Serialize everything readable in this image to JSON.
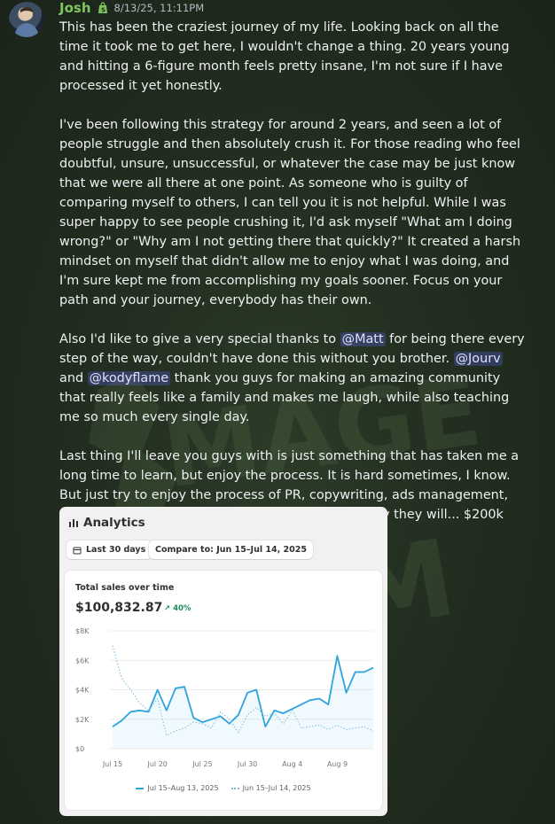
{
  "message": {
    "username": "Josh",
    "timestamp": "8/13/25, 11:11PM",
    "paragraph1": "This has been the craziest journey of my life. Looking back on all the time it took me to get here, I wouldn't change a thing. 20 years young and hitting a 6-figure month feels pretty insane, I'm not sure if I have processed it yet honestly.",
    "paragraph2": "I've been following this strategy for around 2 years, and seen a lot of people struggle and then absolutely crush it. For those reading who feel doubtful, unsure, unsuccessful, or whatever the case may be just know that we were all there at one point.  As someone who is guilty of comparing myself to others, I can tell you it is not helpful. While I was super happy to see people crushing it, I'd ask myself \"What am I doing wrong?\" or \"Why am I not getting there that quickly?\" It created a harsh mindset on myself that didn't allow me to enjoy what I was doing, and I'm sure kept me from accomplishing my goals sooner. Focus on your path and your journey, everybody has their own.",
    "p3_part1": "Also I'd like to give a very special thanks to ",
    "mention_matt": "@Matt",
    "p3_part2": " for being there every step of the way, couldn't have done this without you brother. ",
    "mention_jourv": "@Jourv",
    "p3_part3": "  and ",
    "mention_kodyflame": "@kodyflame",
    "p3_part4": " thank you guys for making an amazing community that really feels like a family and makes me laugh, while also teaching me so much every single day.",
    "paragraph4": "Last thing I'll leave you guys with is just something that has taken me a long time to learn, but enjoy the process. It is hard sometimes, I know. But just try to enjoy the process of PR, copywriting, ads management, even when things aren't going your way. Eventually they will... $200k month next ",
    "emoji": "saluting-face-emoji"
  },
  "analytics": {
    "title": "Analytics",
    "range_label": "Last 30 days",
    "compare_label": "Compare to: Jun 15–Jul 14, 2025",
    "sales_label": "Total sales over time",
    "sales_value": "$100,832.87",
    "sales_change": "40%",
    "legend_current": "Jul 15–Aug 13, 2025",
    "legend_previous": "Jun 15–Jul 14, 2025"
  },
  "chart_data": {
    "type": "line",
    "title": "Total sales over time",
    "y_ticks": [
      "$8K",
      "$6K",
      "$4K",
      "$2K",
      "$0"
    ],
    "x_ticks": [
      "Jul 15",
      "Jul 20",
      "Jul 25",
      "Jul 30",
      "Aug 4",
      "Aug 9"
    ],
    "ylim": [
      0,
      8000
    ],
    "x": [
      "Jul 15",
      "Jul 16",
      "Jul 17",
      "Jul 18",
      "Jul 19",
      "Jul 20",
      "Jul 21",
      "Jul 22",
      "Jul 23",
      "Jul 24",
      "Jul 25",
      "Jul 26",
      "Jul 27",
      "Jul 28",
      "Jul 29",
      "Jul 30",
      "Jul 31",
      "Aug 1",
      "Aug 2",
      "Aug 3",
      "Aug 4",
      "Aug 5",
      "Aug 6",
      "Aug 7",
      "Aug 8",
      "Aug 9",
      "Aug 10",
      "Aug 11",
      "Aug 12",
      "Aug 13"
    ],
    "series": [
      {
        "name": "Jul 15–Aug 13, 2025",
        "style": "solid",
        "color": "#2ea3dc",
        "values": [
          1500,
          1900,
          2500,
          2600,
          2500,
          4000,
          2600,
          4100,
          4200,
          2100,
          1800,
          2000,
          2200,
          1700,
          2300,
          3800,
          4000,
          1500,
          2600,
          2400,
          2700,
          3000,
          3300,
          3400,
          3000,
          6300,
          3800,
          5200,
          5200,
          5500
        ]
      },
      {
        "name": "Jun 15–Jul 14, 2025",
        "style": "dotted",
        "color": "#8cc3e3",
        "values": [
          7000,
          4800,
          4000,
          3100,
          2600,
          3400,
          900,
          1200,
          1400,
          1800,
          1700,
          1400,
          2500,
          2000,
          1100,
          2300,
          2800,
          2200,
          2400,
          1700,
          2600,
          1400,
          1500,
          1600,
          1300,
          1600,
          1300,
          1400,
          1500,
          1200
        ]
      }
    ],
    "grid": true,
    "legend": "bottom-center"
  }
}
